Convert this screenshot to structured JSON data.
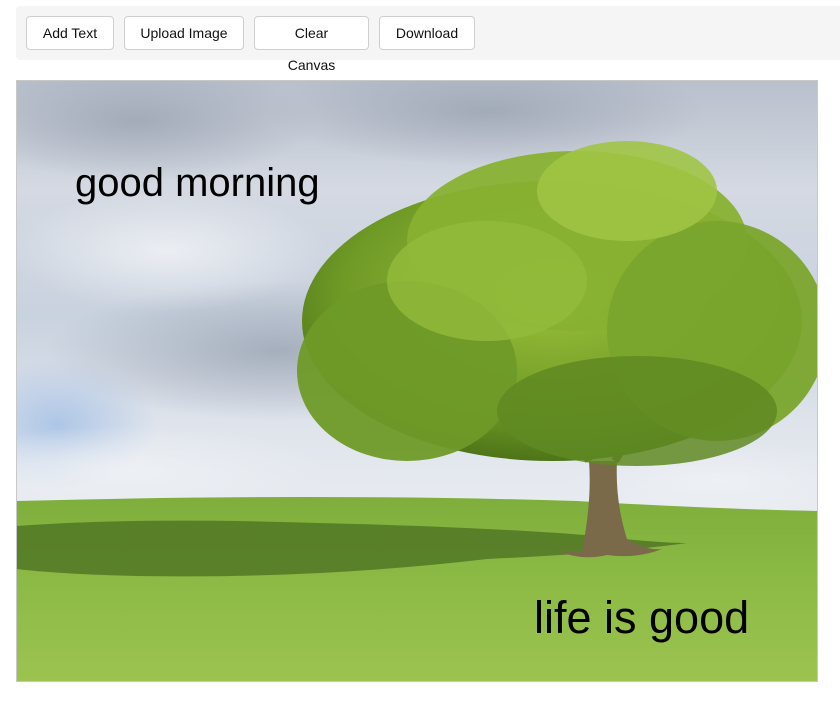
{
  "toolbar": {
    "add_text_label": "Add Text",
    "upload_image_label": "Upload Image",
    "clear_canvas_label": "Clear Canvas",
    "download_label": "Download"
  },
  "canvas": {
    "image_icon": "landscape-photo",
    "texts": [
      {
        "content": "good morning",
        "color": "#000000"
      },
      {
        "content": "life is good",
        "color": "#000000"
      }
    ]
  },
  "colors": {
    "toolbar_bg": "#f5f5f5",
    "button_border": "#cfcfcf",
    "canvas_border": "#c8c8c8"
  }
}
